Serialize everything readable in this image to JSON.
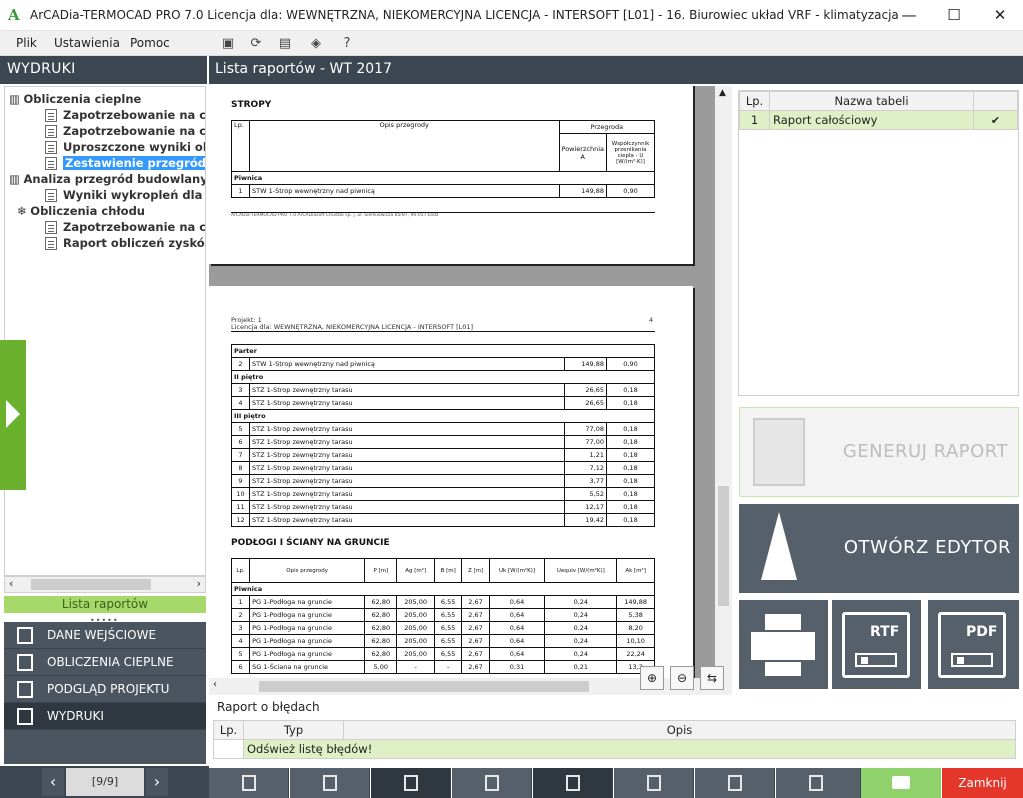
{
  "window": {
    "title": "ArCADia-TERMOCAD PRO 7.0 Licencja dla: WEWNĘTRZNA, NIEKOMERCYJNA LICENCJA - INTERSOFT [L01] - 16. Biurowiec układ VRF - klimatyzacja",
    "minimize": "—",
    "maximize": "☐",
    "close": "✕",
    "logo": "A"
  },
  "menu": {
    "plik": "Plik",
    "ustawienia": "Ustawienia",
    "pomoc": "Pomoc",
    "help_icon": "?"
  },
  "left": {
    "header": "WYDRUKI",
    "tree": [
      {
        "label": "Obliczenia cieplne"
      },
      {
        "label": "Zapotrzebowanie na ciep"
      },
      {
        "label": "Zapotrzebowanie na ciep"
      },
      {
        "label": "Uproszczone wyniki oblic"
      },
      {
        "label": "Zestawienie przegród"
      },
      {
        "label": "Analiza przegród budowlanych"
      },
      {
        "label": "Wyniki wykropleń dla przz"
      },
      {
        "label": "Obliczenia chłodu"
      },
      {
        "label": "Zapotrzebowanie na chłó"
      },
      {
        "label": "Raport obliczeń zysków c"
      }
    ],
    "lista_tab": "Lista raportów",
    "nav": {
      "dane": "DANE WEJŚCIOWE",
      "obliczenia": "OBLICZENIA CIEPLNE",
      "podglad": "PODGLĄD PROJEKTU",
      "wydruki": "WYDRUKI"
    },
    "page_indicator": "[9/9]",
    "prev": "‹",
    "next": "›"
  },
  "main": {
    "header": "Lista raportów - WT 2017"
  },
  "report": {
    "page1": {
      "section": "STROPY",
      "col_lp": "Lp.",
      "col_opis": "Opis przegrody",
      "col_przegroda": "Przegroda",
      "col_pow": "Powierzchnia A",
      "col_wsp": "Współczynnik przenikania ciepła - U [W/(m²·K)]",
      "group": "Piwnica",
      "row": {
        "lp": "1",
        "opis": "STW 1-Strop wewnętrzny nad piwnicą",
        "a": "149,88",
        "u": "0,90"
      },
      "footer": "ArCADia-TERMOCAD PRO 7.0 ArCADiasoft Chudzik sp. j. ul. Sienkiewicza 85/87, 90-057 Łódź"
    },
    "page2": {
      "project": "Projekt: 1",
      "page_no": "4",
      "license": "Licencja dla: WEWNĘTRZNA, NIEKOMERCYJNA LICENCJA - INTERSOFT [L01]",
      "groups": [
        {
          "name": "Parter",
          "rows": [
            {
              "lp": "2",
              "opis": "STW 1-Strop wewnętrzny nad piwnicą",
              "a": "149,88",
              "u": "0,90"
            }
          ]
        },
        {
          "name": "II piętro",
          "rows": [
            {
              "lp": "3",
              "opis": "STZ 1-Strop zewnętrzny tarasu",
              "a": "26,65",
              "u": "0,18"
            },
            {
              "lp": "4",
              "opis": "STZ 1-Strop zewnętrzny tarasu",
              "a": "26,65",
              "u": "0,18"
            }
          ]
        },
        {
          "name": "III piętro",
          "rows": [
            {
              "lp": "5",
              "opis": "STZ 1-Strop zewnętrzny tarasu",
              "a": "77,08",
              "u": "0,18"
            },
            {
              "lp": "6",
              "opis": "STZ 1-Strop zewnętrzny tarasu",
              "a": "77,00",
              "u": "0,18"
            },
            {
              "lp": "7",
              "opis": "STZ 1-Strop zewnętrzny tarasu",
              "a": "1,21",
              "u": "0,18"
            },
            {
              "lp": "8",
              "opis": "STZ 1-Strop zewnętrzny tarasu",
              "a": "7,12",
              "u": "0,18"
            },
            {
              "lp": "9",
              "opis": "STZ 1-Strop zewnętrzny tarasu",
              "a": "3,77",
              "u": "0,18"
            },
            {
              "lp": "10",
              "opis": "STZ 1-Strop zewnętrzny tarasu",
              "a": "5,52",
              "u": "0,18"
            },
            {
              "lp": "11",
              "opis": "STZ 1-Strop zewnętrzny tarasu",
              "a": "12,17",
              "u": "0,18"
            },
            {
              "lp": "12",
              "opis": "STZ 1-Strop zewnętrzny tarasu",
              "a": "19,42",
              "u": "0,18"
            }
          ]
        }
      ],
      "section2": "PODŁOGI I ŚCIANY NA GRUNCIE",
      "ground_headers": [
        "Lp.",
        "Opis przegrody",
        "P [m]",
        "Ag [m²]",
        "B [m]",
        "Z [m]",
        "Uk [W/(m²K)]",
        "Uequiv [W/(m²K)]",
        "Ak [m²]"
      ],
      "ground_group": "Piwnica",
      "ground_rows": [
        [
          "1",
          "PG 1-Podłoga na gruncie",
          "62,80",
          "205,00",
          "6,55",
          "2,67",
          "0,64",
          "0,24",
          "149,88"
        ],
        [
          "2",
          "PG 1-Podłoga na gruncie",
          "62,80",
          "205,00",
          "6,55",
          "2,67",
          "0,64",
          "0,24",
          "5,38"
        ],
        [
          "3",
          "PG 1-Podłoga na gruncie",
          "62,80",
          "205,00",
          "6,55",
          "2,67",
          "0,64",
          "0,24",
          "8,20"
        ],
        [
          "4",
          "PG 1-Podłoga na gruncie",
          "62,80",
          "205,00",
          "6,55",
          "2,67",
          "0,64",
          "0,24",
          "10,10"
        ],
        [
          "5",
          "PG 1-Podłoga na gruncie",
          "62,80",
          "205,00",
          "6,55",
          "2,67",
          "0,64",
          "0,24",
          "22,24"
        ],
        [
          "6",
          "SG 1-Ściana na gruncie",
          "5,00",
          "-",
          "-",
          "2,67",
          "0,31",
          "0,21",
          "13,3"
        ]
      ]
    }
  },
  "right": {
    "col_lp": "Lp.",
    "col_nazwa": "Nazwa tabeli",
    "row": {
      "lp": "1",
      "name": "Raport całościowy",
      "check": "✔"
    },
    "generuj": "GENERUJ RAPORT",
    "otworz": "OTWÓRZ EDYTOR",
    "rtf": "RTF",
    "pdf": "PDF"
  },
  "errors": {
    "title": "Raport o błędach",
    "col_lp": "Lp.",
    "col_typ": "Typ",
    "col_opis": "Opis",
    "row": "Odśwież listę błędów!"
  },
  "bottom": {
    "close": "Zamknij"
  }
}
